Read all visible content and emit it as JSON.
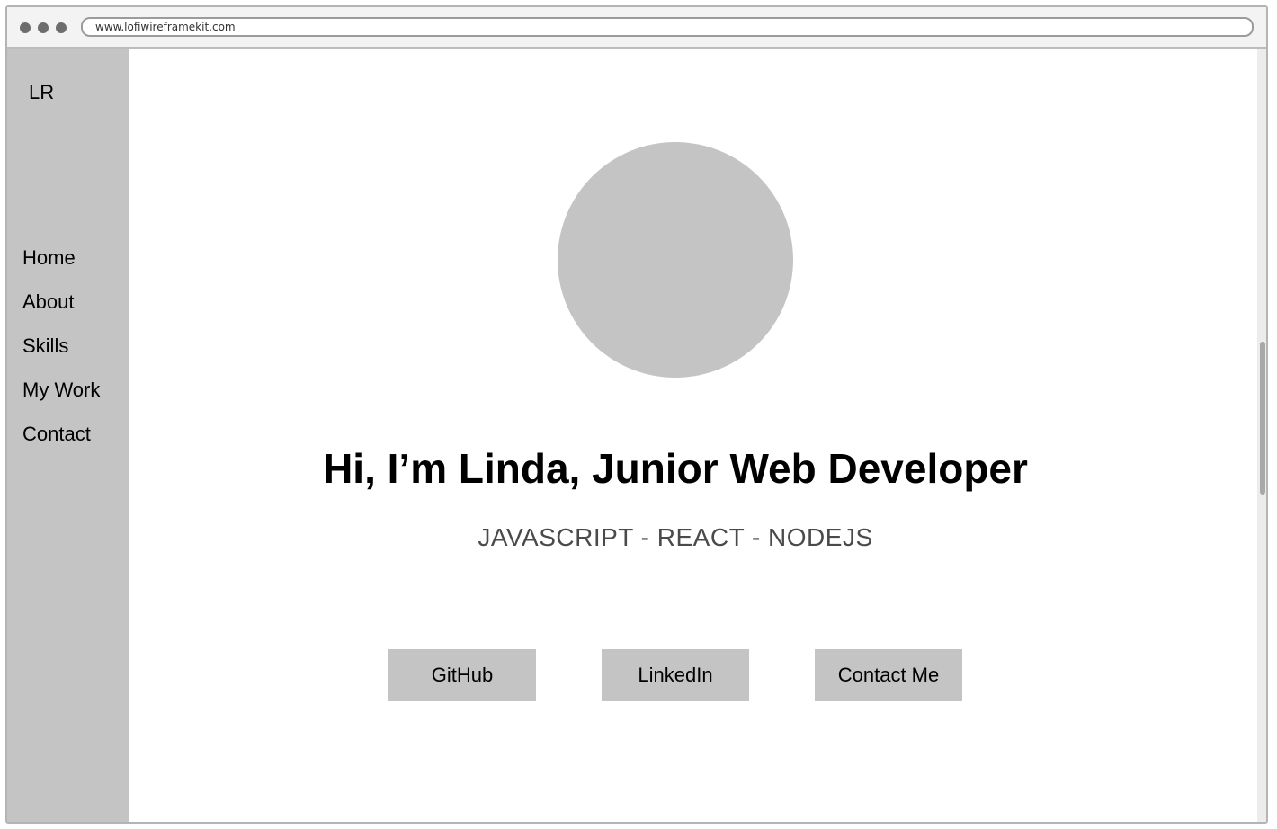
{
  "browser": {
    "url": "www.lofiwireframekit.com"
  },
  "sidebar": {
    "logo": "LR",
    "items": [
      {
        "label": "Home"
      },
      {
        "label": "About"
      },
      {
        "label": "Skills"
      },
      {
        "label": "My Work"
      },
      {
        "label": "Contact"
      }
    ]
  },
  "hero": {
    "headline": "Hi, I’m Linda, Junior Web Developer",
    "skills": "JAVASCRIPT - REACT - NODEJS",
    "buttons": {
      "github": "GitHub",
      "linkedin": "LinkedIn",
      "contact": "Contact Me"
    }
  },
  "colors": {
    "placeholder_gray": "#c4c4c4",
    "text": "#000000",
    "subtext": "#4a4a4a"
  }
}
